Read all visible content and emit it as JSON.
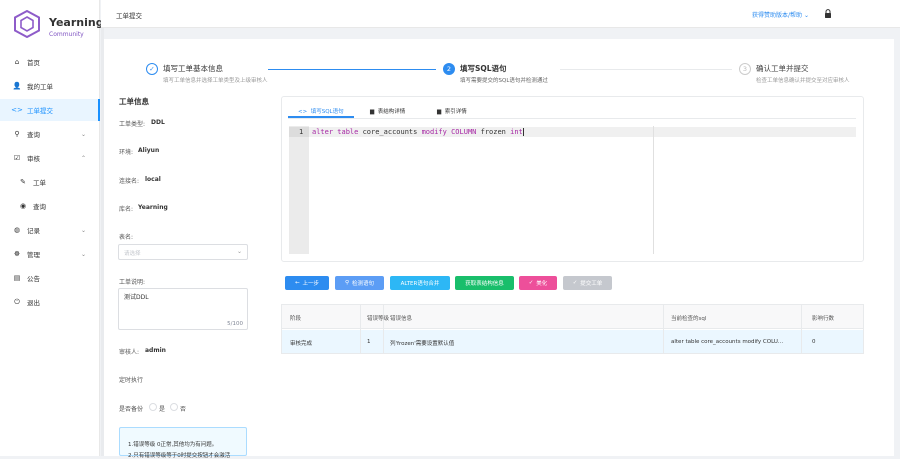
{
  "brand": {
    "name": "Yearning",
    "sub": "Community",
    "color": "#7f53c2"
  },
  "header": {
    "title": "工单提交",
    "help": "获得赞助版本/帮助"
  },
  "nav": [
    {
      "label": "首页",
      "icon": "home-icon",
      "glyph": "⌂"
    },
    {
      "label": "我的工单",
      "icon": "user-icon",
      "glyph": "👤"
    },
    {
      "label": "工单提交",
      "icon": "code-icon",
      "glyph": "<>"
    },
    {
      "label": "查询",
      "icon": "search-icon",
      "glyph": "⚲"
    },
    {
      "label": "审核",
      "icon": "audit-icon",
      "glyph": "☑"
    },
    {
      "label": "工单",
      "icon": "pencil-icon",
      "glyph": "✎"
    },
    {
      "label": "查询",
      "icon": "rss-icon",
      "glyph": "◉"
    },
    {
      "label": "记录",
      "icon": "record-icon",
      "glyph": "◍"
    },
    {
      "label": "管理",
      "icon": "manage-icon",
      "glyph": "☸"
    },
    {
      "label": "公告",
      "icon": "notice-icon",
      "glyph": "▤"
    },
    {
      "label": "退出",
      "icon": "logout-icon",
      "glyph": "⏻"
    }
  ],
  "steps": [
    {
      "title": "填写工单基本信息",
      "desc": "填写工单信息并选择工单类型及上级审核人",
      "mark": "✓"
    },
    {
      "title": "填写SQL语句",
      "desc": "填写需要提交的SQL语句并检测通过",
      "mark": "2"
    },
    {
      "title": "确认工单并提交",
      "desc": "检查工单信息确认并提交至对应审核人",
      "mark": "3"
    }
  ],
  "info": {
    "heading": "工单信息",
    "type_label": "工单类型:",
    "type_value": "DDL",
    "env_label": "环境:",
    "env_value": "Aliyun",
    "conn_label": "连接名:",
    "conn_value": "local",
    "db_label": "库名:",
    "db_value": "Yearning",
    "table_label": "表名:",
    "table_placeholder": "请选择",
    "desc_label": "工单说明:",
    "desc_value": "测试DDL",
    "desc_count": "5/100",
    "auditor_label": "审核人:",
    "auditor_value": "admin",
    "timer_label": "定时执行",
    "backup_label": "是否备份",
    "backup_yes": "是",
    "backup_no": "否",
    "notes": [
      "1.错误等级 0正常,其他均为有问题。",
      "2.只有错误等级等于0时提交按钮才会激活"
    ]
  },
  "editor": {
    "tabs": [
      "填写SQL语句",
      "表结构详情",
      "索引详情"
    ],
    "line_no": "1",
    "sql": [
      {
        "t": "alter table",
        "c": "#a626a4"
      },
      {
        "t": " core_accounts ",
        "c": "#333333"
      },
      {
        "t": "modify",
        "c": "#a626a4"
      },
      {
        "t": " COLUMN",
        "c": "#a626a4"
      },
      {
        "t": " frozen ",
        "c": "#333333"
      },
      {
        "t": "int",
        "c": "#a626a4"
      }
    ]
  },
  "buttons": [
    {
      "label": "上一步",
      "icon": "←",
      "color": "#2d8cf0"
    },
    {
      "label": "检测语句",
      "icon": "⚲",
      "color": "#5c9df5"
    },
    {
      "label": "ALTER语句合并",
      "icon": "",
      "color": "#2db7f5"
    },
    {
      "label": "获取表结构信息",
      "icon": "",
      "color": "#19be6b"
    },
    {
      "label": "美化",
      "icon": "✓",
      "color": "#ed4f9a"
    },
    {
      "label": "提交工单",
      "icon": "✓",
      "color": "#c5c8ce"
    }
  ],
  "table": {
    "headers": [
      "阶段",
      "错误等级",
      "错误信息",
      "当前检查的sql",
      "影响行数"
    ],
    "row": [
      "审核完成",
      "1",
      "列'frozen'需要设置默认值",
      "alter table core_accounts modify COLU...",
      "0"
    ]
  }
}
